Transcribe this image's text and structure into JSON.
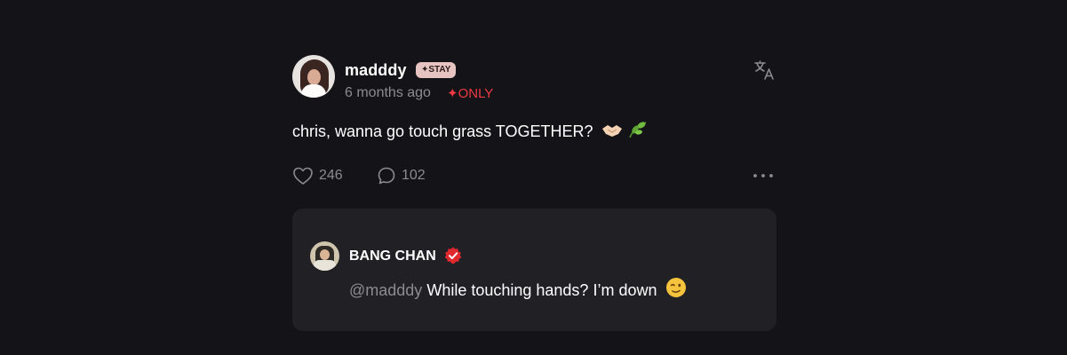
{
  "post": {
    "username": "madddy",
    "badge": "✦STAY",
    "timestamp": "6 months ago",
    "only_tag": "✦ONLY",
    "message": "chris, wanna go touch grass TOGETHER?",
    "likes": "246",
    "comments": "102",
    "icons": {
      "translate": "translate-icon",
      "like": "heart-icon",
      "comment": "comment-icon",
      "more": "more-dots-icon",
      "emoji": [
        "handshake-emoji",
        "herb-emoji"
      ]
    }
  },
  "reply": {
    "name": "BANG CHAN",
    "mention": "@madddy",
    "text": "While touching hands? I’m down",
    "verified_color": "#e0282f",
    "emoji": "winking-face-emoji"
  },
  "colors": {
    "background": "#141317",
    "card": "#212025",
    "muted": "#8d8b92",
    "accent_red": "#ee3a43",
    "badge_bg": "#e7c4c1"
  }
}
